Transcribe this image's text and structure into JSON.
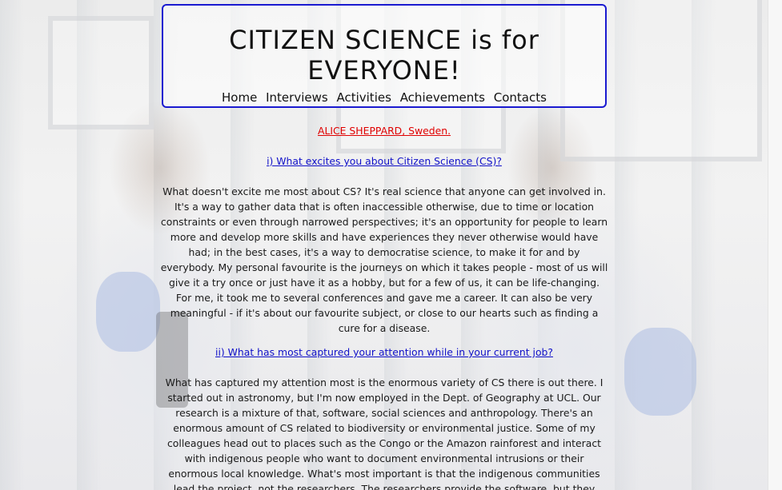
{
  "header": {
    "title": "CITIZEN SCIENCE is for EVERYONE!",
    "nav": [
      "Home",
      "Interviews",
      "Activities",
      "Achievements",
      "Contacts"
    ]
  },
  "interview": {
    "name": "ALICE SHEPPARD, Sweden.",
    "questions": [
      {
        "question": "i) What excites you about Citizen Science (CS)?",
        "answer": "What doesn't excite me most about CS? It's real science that anyone can get involved in. It's a way to gather data that is often inaccessible otherwise, due to time or location constraints or even through narrowed perspectives; it's an opportunity for people to learn more and develop more skills and have experiences they never otherwise would have had; in the best cases, it's a way to democratise science, to make it for and by everybody. My personal favourite is the journeys on which it takes people - most of us will give it a try once or just have it as a hobby, but for a few of us, it can be life-changing. For me, it took me to several conferences and gave me a career. It can also be very meaningful - if it's about our favourite subject, or close to our hearts such as finding a cure for a disease."
      },
      {
        "question": "ii) What has most captured your attention while in your current job?",
        "answer": "What has captured my attention most is the enormous variety of CS there is out there. I started out in astronomy, but I'm now employed in the Dept. of Geography at UCL. Our research is a mixture of that, software, social sciences and anthropology. There's an enormous amount of CS related to biodiversity or environmental justice. Some of my colleagues head out to places such as the Congo or the Amazon rainforest and interact with indigenous people who want to document environmental intrusions or their enormous local knowledge. What's most important is that the indigenous communities lead the project, not the researchers. The researchers provide the software, but they don't make the decisions; it's a bottom-up approach rather than the top-down"
      }
    ]
  }
}
